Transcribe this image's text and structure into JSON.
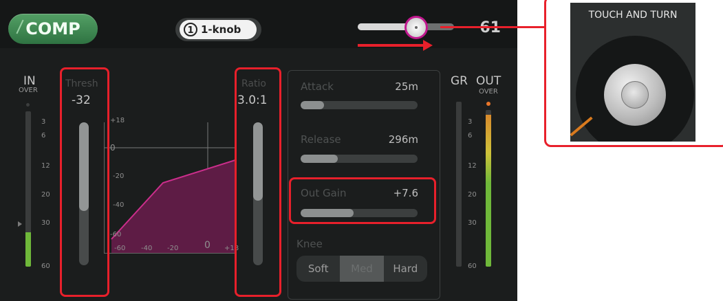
{
  "header": {
    "comp_button": "COMP",
    "knob_number": "1",
    "knob_label": "1-knob",
    "slider_fraction": 0.62,
    "value": "61"
  },
  "in_meter": {
    "title": "IN",
    "over": "OVER",
    "scale": [
      "3",
      "6",
      "12",
      "20",
      "30",
      "60"
    ],
    "level_fraction": 0.22
  },
  "out_meter": {
    "gr_title": "GR",
    "out_title": "OUT",
    "over": "OVER",
    "scale": [
      "3",
      "6",
      "12",
      "20",
      "30",
      "60"
    ],
    "level_fraction": 0.97
  },
  "threshold": {
    "label": "Thresh",
    "value": "-32",
    "fraction": 0.62
  },
  "ratio": {
    "label": "Ratio",
    "value": "3.0:1",
    "fraction": 0.55
  },
  "graph": {
    "y_ticks": [
      "+18",
      "0",
      "-20",
      "-40",
      "-60"
    ],
    "x_ticks": [
      "-60",
      "-40",
      "-20",
      "0",
      "+18"
    ]
  },
  "params": {
    "attack": {
      "label": "Attack",
      "value": "25m",
      "fraction": 0.2
    },
    "release": {
      "label": "Release",
      "value": "296m",
      "fraction": 0.32
    },
    "out_gain": {
      "label": "Out Gain",
      "value": "+7.6",
      "fraction": 0.45
    }
  },
  "knee": {
    "label": "Knee",
    "options": [
      "Soft",
      "Med",
      "Hard"
    ],
    "selected": "Med"
  },
  "callout": {
    "label": "TOUCH AND TURN"
  },
  "colors": {
    "highlight": "#e8202b",
    "comp_green": "#3f8a52",
    "thumb_ring": "#c1188f",
    "curve": "#cc2e8c",
    "meter_green": "#6fb83a"
  }
}
